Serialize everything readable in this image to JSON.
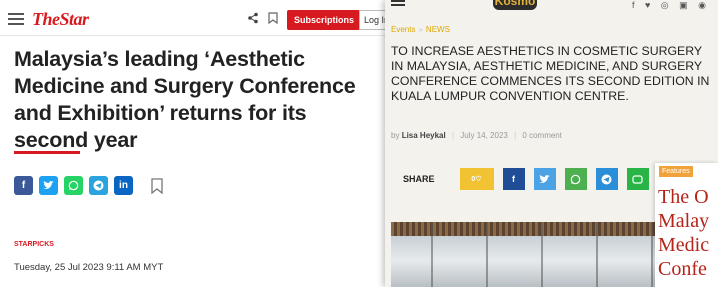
{
  "left": {
    "logo": "TheStar",
    "subscriptions_label": "Subscriptions",
    "login_label": "Log In",
    "headline": "Malaysia’s leading ‘Aesthetic Medicine and Surgery Conference and Exhibition’ returns for its second year",
    "social_icons": [
      "facebook-icon",
      "twitter-icon",
      "whatsapp-icon",
      "telegram-icon",
      "linkedin-icon"
    ],
    "kicker": "STARPICKS",
    "dateline": "Tuesday, 25 Jul 2023   9:11 AM MYT",
    "accent_color": "#d71920"
  },
  "right": {
    "logo": "Kosmo",
    "breadcrumb": [
      "Events",
      "NEWS"
    ],
    "title": "TO INCREASE AESTHETICS IN COSMETIC SURGERY IN MALAYSIA, AESTHETIC MEDICINE, AND SURGERY CONFERENCE COMMENCES ITS SECOND EDITION IN KUALA LUMPUR CONVENTION CENTRE.",
    "meta": {
      "by": "by",
      "author": "Lisa Heykal",
      "date": "July 14, 2023",
      "comments": "0 comment"
    },
    "share_label": "SHARE",
    "like_label": "0♡",
    "share_icons": [
      "facebook-icon",
      "twitter-icon",
      "whatsapp-icon",
      "telegram-icon",
      "line-icon"
    ],
    "accent_color": "#e0a800"
  },
  "card": {
    "tag": "Features",
    "title_lines": [
      "The O",
      "Malay",
      "Medic",
      "Confe"
    ]
  }
}
